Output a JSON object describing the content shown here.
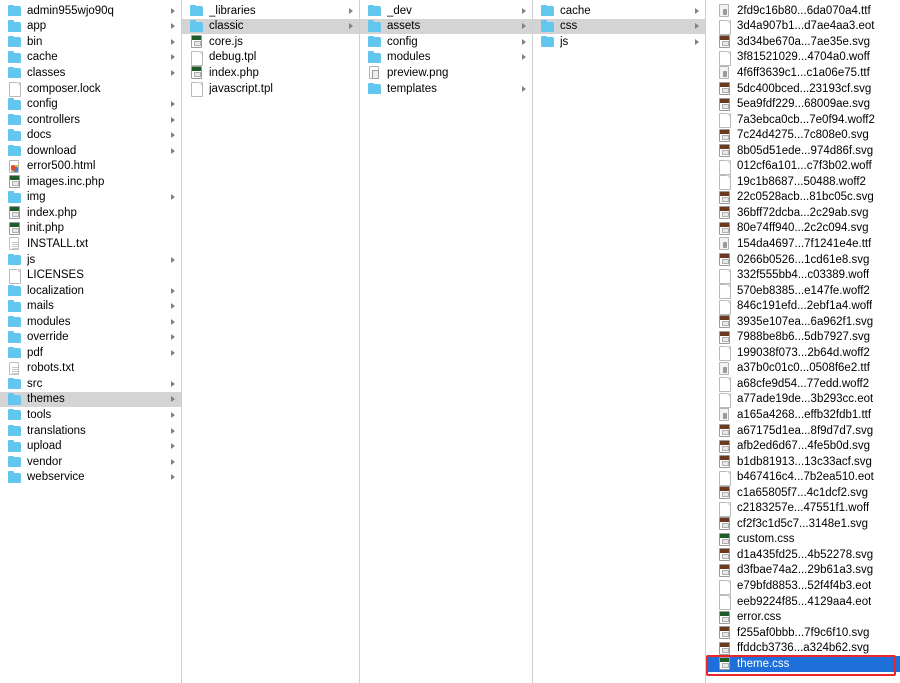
{
  "app": "macos-finder-column-view",
  "annotation": {
    "color": "#e8262b",
    "target": "theme.css"
  },
  "colors": {
    "selected_active_bg": "#1e6fd9",
    "selected_inactive_bg": "#d4d4d4",
    "folder_icon": "#63c6ef",
    "annotation_red": "#e8262b"
  },
  "columns": [
    {
      "name": "root-column",
      "items": [
        {
          "label": "admin955wjo90q",
          "icon": "folder-icon",
          "kind": "folder",
          "arrow": true,
          "selected": "none"
        },
        {
          "label": "app",
          "icon": "folder-icon",
          "kind": "folder",
          "arrow": true,
          "selected": "none"
        },
        {
          "label": "bin",
          "icon": "folder-icon",
          "kind": "folder",
          "arrow": true,
          "selected": "none"
        },
        {
          "label": "cache",
          "icon": "folder-icon",
          "kind": "folder",
          "arrow": true,
          "selected": "none"
        },
        {
          "label": "classes",
          "icon": "folder-icon",
          "kind": "folder",
          "arrow": true,
          "selected": "none"
        },
        {
          "label": "composer.lock",
          "icon": "document-icon",
          "kind": "doc",
          "arrow": false,
          "selected": "none"
        },
        {
          "label": "config",
          "icon": "folder-icon",
          "kind": "folder",
          "arrow": true,
          "selected": "none"
        },
        {
          "label": "controllers",
          "icon": "folder-icon",
          "kind": "folder",
          "arrow": true,
          "selected": "none"
        },
        {
          "label": "docs",
          "icon": "folder-icon",
          "kind": "folder",
          "arrow": true,
          "selected": "none"
        },
        {
          "label": "download",
          "icon": "folder-icon",
          "kind": "folder",
          "arrow": true,
          "selected": "none"
        },
        {
          "label": "error500.html",
          "icon": "html-file-icon",
          "kind": "html",
          "arrow": false,
          "selected": "none"
        },
        {
          "label": "images.inc.php",
          "icon": "php-file-icon",
          "kind": "php",
          "arrow": false,
          "selected": "none"
        },
        {
          "label": "img",
          "icon": "folder-icon",
          "kind": "folder",
          "arrow": true,
          "selected": "none"
        },
        {
          "label": "index.php",
          "icon": "php-file-icon",
          "kind": "php",
          "arrow": false,
          "selected": "none"
        },
        {
          "label": "init.php",
          "icon": "php-file-icon",
          "kind": "php",
          "arrow": false,
          "selected": "none"
        },
        {
          "label": "INSTALL.txt",
          "icon": "text-file-icon",
          "kind": "txt",
          "arrow": false,
          "selected": "none"
        },
        {
          "label": "js",
          "icon": "folder-icon",
          "kind": "folder",
          "arrow": true,
          "selected": "none"
        },
        {
          "label": "LICENSES",
          "icon": "document-icon",
          "kind": "doc",
          "arrow": false,
          "selected": "none"
        },
        {
          "label": "localization",
          "icon": "folder-icon",
          "kind": "folder",
          "arrow": true,
          "selected": "none"
        },
        {
          "label": "mails",
          "icon": "folder-icon",
          "kind": "folder",
          "arrow": true,
          "selected": "none"
        },
        {
          "label": "modules",
          "icon": "folder-icon",
          "kind": "folder",
          "arrow": true,
          "selected": "none"
        },
        {
          "label": "override",
          "icon": "folder-icon",
          "kind": "folder",
          "arrow": true,
          "selected": "none"
        },
        {
          "label": "pdf",
          "icon": "folder-icon",
          "kind": "folder",
          "arrow": true,
          "selected": "none"
        },
        {
          "label": "robots.txt",
          "icon": "text-file-icon",
          "kind": "txt",
          "arrow": false,
          "selected": "none"
        },
        {
          "label": "src",
          "icon": "folder-icon",
          "kind": "folder",
          "arrow": true,
          "selected": "none"
        },
        {
          "label": "themes",
          "icon": "folder-icon",
          "kind": "folder",
          "arrow": true,
          "selected": "inactive"
        },
        {
          "label": "tools",
          "icon": "folder-icon",
          "kind": "folder",
          "arrow": true,
          "selected": "none"
        },
        {
          "label": "translations",
          "icon": "folder-icon",
          "kind": "folder",
          "arrow": true,
          "selected": "none"
        },
        {
          "label": "upload",
          "icon": "folder-icon",
          "kind": "folder",
          "arrow": true,
          "selected": "none"
        },
        {
          "label": "vendor",
          "icon": "folder-icon",
          "kind": "folder",
          "arrow": true,
          "selected": "none"
        },
        {
          "label": "webservice",
          "icon": "folder-icon",
          "kind": "folder",
          "arrow": true,
          "selected": "none"
        }
      ]
    },
    {
      "name": "themes-column",
      "items": [
        {
          "label": "_libraries",
          "icon": "folder-icon",
          "kind": "folder",
          "arrow": true,
          "selected": "none"
        },
        {
          "label": "classic",
          "icon": "folder-icon",
          "kind": "folder",
          "arrow": true,
          "selected": "inactive"
        },
        {
          "label": "core.js",
          "icon": "js-file-icon",
          "kind": "php",
          "arrow": false,
          "selected": "none"
        },
        {
          "label": "debug.tpl",
          "icon": "document-icon",
          "kind": "doc",
          "arrow": false,
          "selected": "none"
        },
        {
          "label": "index.php",
          "icon": "php-file-icon",
          "kind": "php",
          "arrow": false,
          "selected": "none"
        },
        {
          "label": "javascript.tpl",
          "icon": "document-icon",
          "kind": "doc",
          "arrow": false,
          "selected": "none"
        }
      ]
    },
    {
      "name": "classic-column",
      "items": [
        {
          "label": "_dev",
          "icon": "folder-icon",
          "kind": "folder",
          "arrow": true,
          "selected": "none"
        },
        {
          "label": "assets",
          "icon": "folder-icon",
          "kind": "folder",
          "arrow": true,
          "selected": "inactive"
        },
        {
          "label": "config",
          "icon": "folder-icon",
          "kind": "folder",
          "arrow": true,
          "selected": "none"
        },
        {
          "label": "modules",
          "icon": "folder-icon",
          "kind": "folder",
          "arrow": true,
          "selected": "none"
        },
        {
          "label": "preview.png",
          "icon": "image-file-icon",
          "kind": "img",
          "arrow": false,
          "selected": "none"
        },
        {
          "label": "templates",
          "icon": "folder-icon",
          "kind": "folder",
          "arrow": true,
          "selected": "none"
        }
      ]
    },
    {
      "name": "assets-column",
      "items": [
        {
          "label": "cache",
          "icon": "folder-icon",
          "kind": "folder",
          "arrow": true,
          "selected": "none"
        },
        {
          "label": "css",
          "icon": "folder-icon",
          "kind": "folder",
          "arrow": true,
          "selected": "inactive"
        },
        {
          "label": "js",
          "icon": "folder-icon",
          "kind": "folder",
          "arrow": true,
          "selected": "none"
        }
      ]
    },
    {
      "name": "css-column",
      "items": [
        {
          "label": "2fd9c16b80...6da070a4.ttf",
          "icon": "font-file-icon",
          "kind": "font",
          "arrow": false,
          "selected": "none"
        },
        {
          "label": "3d4a907b1...d7ae4aa3.eot",
          "icon": "document-icon",
          "kind": "doc",
          "arrow": false,
          "selected": "none"
        },
        {
          "label": "3d34be670a...7ae35e.svg",
          "icon": "svg-file-icon",
          "kind": "svg",
          "arrow": false,
          "selected": "none"
        },
        {
          "label": "3f81521029...4704a0.woff",
          "icon": "document-icon",
          "kind": "doc",
          "arrow": false,
          "selected": "none"
        },
        {
          "label": "4f6ff3639c1...c1a06e75.ttf",
          "icon": "font-file-icon",
          "kind": "font",
          "arrow": false,
          "selected": "none"
        },
        {
          "label": "5dc400bced...23193cf.svg",
          "icon": "svg-file-icon",
          "kind": "svg",
          "arrow": false,
          "selected": "none"
        },
        {
          "label": "5ea9fdf229...68009ae.svg",
          "icon": "svg-file-icon",
          "kind": "svg",
          "arrow": false,
          "selected": "none"
        },
        {
          "label": "7a3ebca0cb...7e0f94.woff2",
          "icon": "document-icon",
          "kind": "doc",
          "arrow": false,
          "selected": "none"
        },
        {
          "label": "7c24d4275...7c808e0.svg",
          "icon": "svg-file-icon",
          "kind": "svg",
          "arrow": false,
          "selected": "none"
        },
        {
          "label": "8b05d51ede...974d86f.svg",
          "icon": "svg-file-icon",
          "kind": "svg",
          "arrow": false,
          "selected": "none"
        },
        {
          "label": "012cf6a101...c7f3b02.woff",
          "icon": "document-icon",
          "kind": "doc",
          "arrow": false,
          "selected": "none"
        },
        {
          "label": "19c1b8687...50488.woff2",
          "icon": "document-icon",
          "kind": "doc",
          "arrow": false,
          "selected": "none"
        },
        {
          "label": "22c0528acb...81bc05c.svg",
          "icon": "svg-file-icon",
          "kind": "svg",
          "arrow": false,
          "selected": "none"
        },
        {
          "label": "36bff72dcba...2c29ab.svg",
          "icon": "svg-file-icon",
          "kind": "svg",
          "arrow": false,
          "selected": "none"
        },
        {
          "label": "80e74ff940...2c2c094.svg",
          "icon": "svg-file-icon",
          "kind": "svg",
          "arrow": false,
          "selected": "none"
        },
        {
          "label": "154da4697...7f1241e4e.ttf",
          "icon": "font-file-icon",
          "kind": "font",
          "arrow": false,
          "selected": "none"
        },
        {
          "label": "0266b0526...1cd61e8.svg",
          "icon": "svg-file-icon",
          "kind": "svg",
          "arrow": false,
          "selected": "none"
        },
        {
          "label": "332f555bb4...c03389.woff",
          "icon": "document-icon",
          "kind": "doc",
          "arrow": false,
          "selected": "none"
        },
        {
          "label": "570eb8385...e147fe.woff2",
          "icon": "document-icon",
          "kind": "doc",
          "arrow": false,
          "selected": "none"
        },
        {
          "label": "846c191efd...2ebf1a4.woff",
          "icon": "document-icon",
          "kind": "doc",
          "arrow": false,
          "selected": "none"
        },
        {
          "label": "3935e107ea...6a962f1.svg",
          "icon": "svg-file-icon",
          "kind": "svg",
          "arrow": false,
          "selected": "none"
        },
        {
          "label": "7988be8b6...5db7927.svg",
          "icon": "svg-file-icon",
          "kind": "svg",
          "arrow": false,
          "selected": "none"
        },
        {
          "label": "199038f073...2b64d.woff2",
          "icon": "document-icon",
          "kind": "doc",
          "arrow": false,
          "selected": "none"
        },
        {
          "label": "a37b0c01c0...0508f6e2.ttf",
          "icon": "font-file-icon",
          "kind": "font",
          "arrow": false,
          "selected": "none"
        },
        {
          "label": "a68cfe9d54...77edd.woff2",
          "icon": "document-icon",
          "kind": "doc",
          "arrow": false,
          "selected": "none"
        },
        {
          "label": "a77ade19de...3b293cc.eot",
          "icon": "document-icon",
          "kind": "doc",
          "arrow": false,
          "selected": "none"
        },
        {
          "label": "a165a4268...effb32fdb1.ttf",
          "icon": "font-file-icon",
          "kind": "font",
          "arrow": false,
          "selected": "none"
        },
        {
          "label": "a67175d1ea...8f9d7d7.svg",
          "icon": "svg-file-icon",
          "kind": "svg",
          "arrow": false,
          "selected": "none"
        },
        {
          "label": "afb2ed6d67...4fe5b0d.svg",
          "icon": "svg-file-icon",
          "kind": "svg",
          "arrow": false,
          "selected": "none"
        },
        {
          "label": "b1db81913...13c33acf.svg",
          "icon": "svg-file-icon",
          "kind": "svg",
          "arrow": false,
          "selected": "none"
        },
        {
          "label": "b467416c4...7b2ea510.eot",
          "icon": "document-icon",
          "kind": "doc",
          "arrow": false,
          "selected": "none"
        },
        {
          "label": "c1a65805f7...4c1dcf2.svg",
          "icon": "svg-file-icon",
          "kind": "svg",
          "arrow": false,
          "selected": "none"
        },
        {
          "label": "c2183257e...47551f1.woff",
          "icon": "document-icon",
          "kind": "doc",
          "arrow": false,
          "selected": "none"
        },
        {
          "label": "cf2f3c1d5c7...3148e1.svg",
          "icon": "svg-file-icon",
          "kind": "svg",
          "arrow": false,
          "selected": "none"
        },
        {
          "label": "custom.css",
          "icon": "css-file-icon",
          "kind": "css",
          "arrow": false,
          "selected": "none"
        },
        {
          "label": "d1a435fd25...4b52278.svg",
          "icon": "svg-file-icon",
          "kind": "svg",
          "arrow": false,
          "selected": "none"
        },
        {
          "label": "d3fbae74a2...29b61a3.svg",
          "icon": "svg-file-icon",
          "kind": "svg",
          "arrow": false,
          "selected": "none"
        },
        {
          "label": "e79bfd8853...52f4f4b3.eot",
          "icon": "document-icon",
          "kind": "doc",
          "arrow": false,
          "selected": "none"
        },
        {
          "label": "eeb9224f85...4129aa4.eot",
          "icon": "document-icon",
          "kind": "doc",
          "arrow": false,
          "selected": "none"
        },
        {
          "label": "error.css",
          "icon": "css-file-icon",
          "kind": "css",
          "arrow": false,
          "selected": "none"
        },
        {
          "label": "f255af0bbb...7f9c6f10.svg",
          "icon": "svg-file-icon",
          "kind": "svg",
          "arrow": false,
          "selected": "none"
        },
        {
          "label": "ffddcb3736...a324b62.svg",
          "icon": "svg-file-icon",
          "kind": "svg",
          "arrow": false,
          "selected": "none"
        },
        {
          "label": "theme.css",
          "icon": "css-file-icon",
          "kind": "css",
          "arrow": false,
          "selected": "active"
        }
      ]
    }
  ]
}
